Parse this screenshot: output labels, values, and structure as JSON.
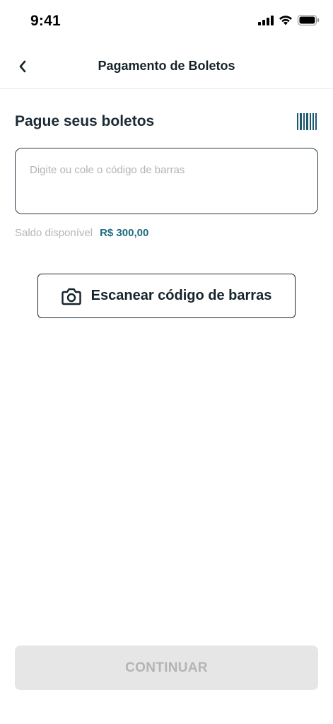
{
  "status_bar": {
    "time": "9:41",
    "icons": [
      "cellular-signal-icon",
      "wifi-icon",
      "battery-icon"
    ]
  },
  "header": {
    "back_icon": "chevron-left-icon",
    "title": "Pagamento de Boletos"
  },
  "section": {
    "title": "Pague seus boletos",
    "barcode_icon": "barcode-icon"
  },
  "input": {
    "value": "",
    "placeholder": "Digite ou cole o código de barras"
  },
  "balance": {
    "label": "Saldo disponível",
    "value": "R$ 300,00"
  },
  "scan_button": {
    "icon": "camera-icon",
    "label": "Escanear código de barras"
  },
  "continue_button": {
    "label": "CONTINUAR",
    "enabled": false
  },
  "colors": {
    "primary_text": "#15232b",
    "accent": "#1e6a80",
    "muted": "#b5b5b5",
    "disabled_bg": "#e6e6e6",
    "disabled_text": "#b4b4b4"
  }
}
